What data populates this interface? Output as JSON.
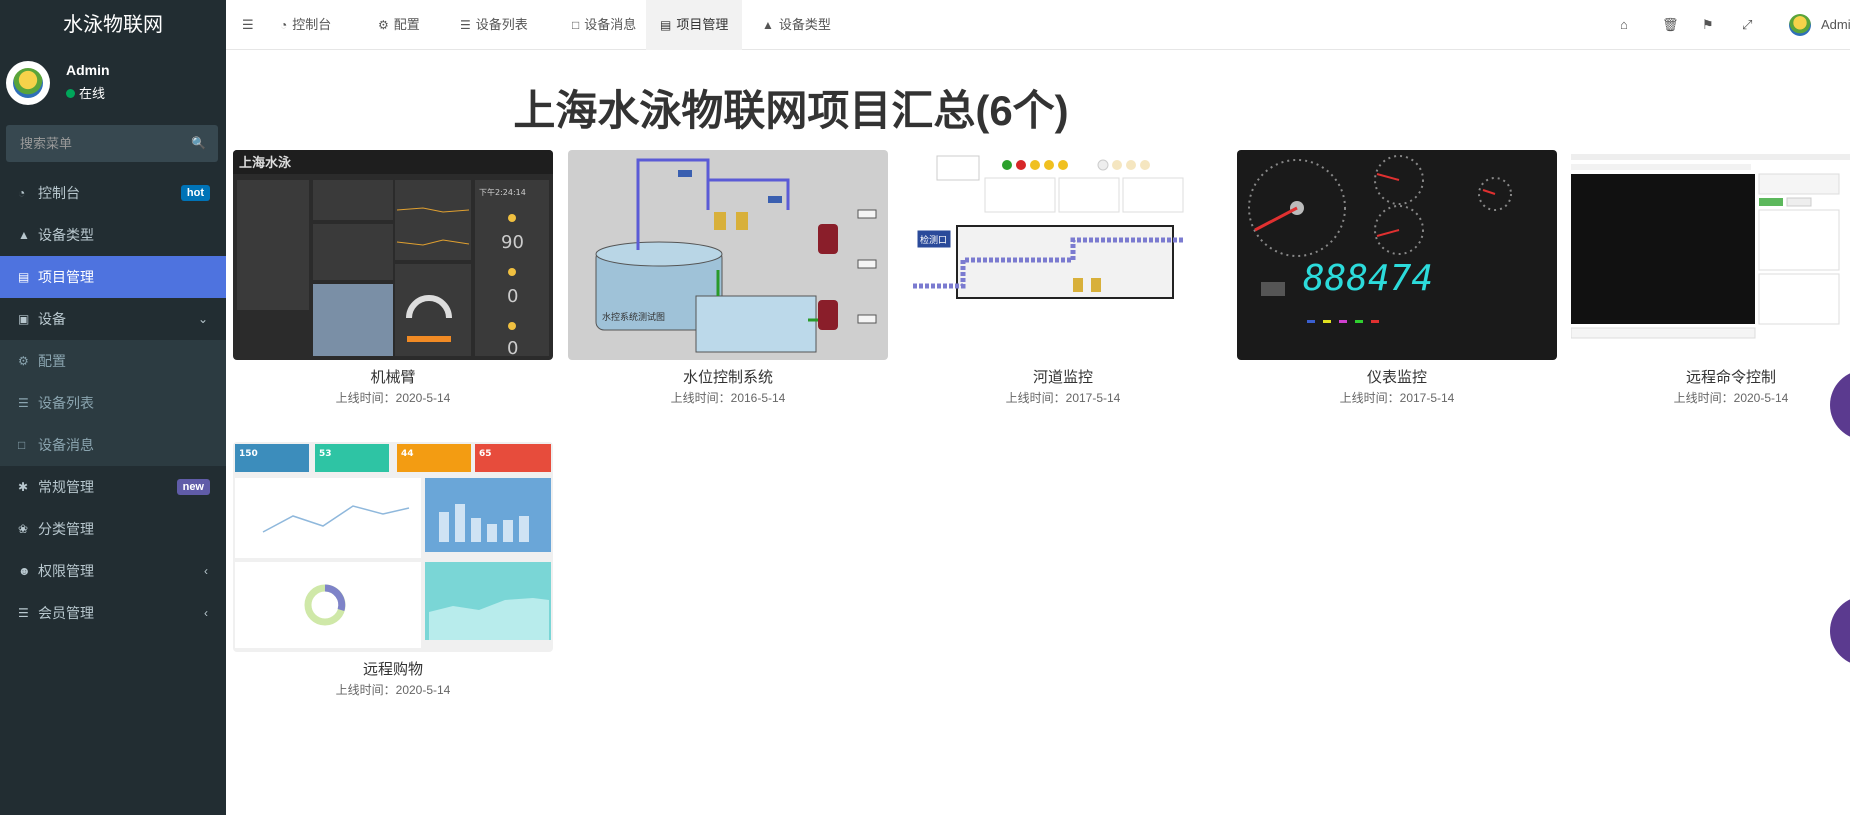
{
  "sidebar": {
    "logo": "水泳物联网",
    "user": {
      "name": "Admin",
      "status": "在线"
    },
    "search_placeholder": "搜索菜单",
    "items": [
      {
        "label": "控制台",
        "icon": "dashboard-icon",
        "badge": "hot"
      },
      {
        "label": "设备类型",
        "icon": "sitemap-icon"
      },
      {
        "label": "项目管理",
        "icon": "inbox-icon",
        "active": true
      },
      {
        "label": "设备",
        "icon": "device-icon"
      },
      {
        "label": "配置",
        "icon": "gear-icon"
      },
      {
        "label": "设备列表",
        "icon": "list-icon"
      },
      {
        "label": "设备消息",
        "icon": "file-icon"
      },
      {
        "label": "常规管理",
        "icon": "cog-icon",
        "badge": "new"
      },
      {
        "label": "分类管理",
        "icon": "leaf-icon"
      },
      {
        "label": "权限管理",
        "icon": "users-icon"
      },
      {
        "label": "会员管理",
        "icon": "list-alt-icon"
      }
    ]
  },
  "topbar": {
    "tabs": [
      "控制台",
      "配置",
      "设备列表",
      "设备消息",
      "项目管理",
      "设备类型"
    ],
    "user": "Admin"
  },
  "main": {
    "title": "上海水泳物联网项目汇总(6个)",
    "date_prefix": "上线时间：",
    "projects": [
      {
        "title": "机械臂",
        "date": "2020-5-14"
      },
      {
        "title": "水位控制系统",
        "date": "2016-5-14"
      },
      {
        "title": "河道监控",
        "date": "2017-5-14"
      },
      {
        "title": "仪表监控",
        "date": "2017-5-14"
      },
      {
        "title": "远程命令控制",
        "date": "2020-5-14"
      },
      {
        "title": "远程购物",
        "date": "2020-5-14"
      }
    ],
    "thumb_text": {
      "robot_header": "上海水泳",
      "robot_time": "下午2:24:14",
      "robot_value_1": "90",
      "robot_value_2": "0",
      "robot_value_3": "0",
      "water_caption": "水控系统测试图",
      "river_label": "检测口",
      "meter_digits": "888474",
      "shop_stat_1": "150",
      "shop_stat_2": "53",
      "shop_stat_3": "44",
      "shop_stat_4": "65"
    },
    "colors": {
      "accent": "#4e73df",
      "sidebar": "#222d32",
      "hot": "#0073b7",
      "new": "#605ca8"
    }
  }
}
